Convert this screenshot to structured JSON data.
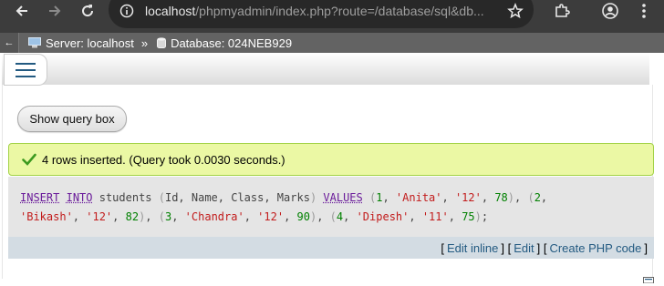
{
  "browser": {
    "url_host": "localhost",
    "url_path": "/phpmyadmin/index.php?route=/database/sql&db..."
  },
  "breadcrumb": {
    "collapse": "←",
    "server": "Server: localhost",
    "separator": "»",
    "database": "Database: 024NEB929"
  },
  "query_box_button": "Show query box",
  "success_message": "4 rows inserted. (Query took 0.0030 seconds.)",
  "sql": {
    "line1": [
      {
        "t": "INSERT",
        "c": "kw2"
      },
      {
        "t": " ",
        "c": ""
      },
      {
        "t": "INTO",
        "c": "kw2"
      },
      {
        "t": " students ",
        "c": "ident"
      },
      {
        "t": "(",
        "c": "pun"
      },
      {
        "t": "Id, Name, Class, Marks",
        "c": "ident"
      },
      {
        "t": ")",
        "c": "pun"
      },
      {
        "t": " ",
        "c": ""
      },
      {
        "t": "VALUES",
        "c": "kw2"
      },
      {
        "t": " ",
        "c": ""
      },
      {
        "t": "(",
        "c": "pun"
      },
      {
        "t": "1",
        "c": "num"
      },
      {
        "t": ", ",
        "c": "ident"
      },
      {
        "t": "'Anita'",
        "c": "str"
      },
      {
        "t": ", ",
        "c": "ident"
      },
      {
        "t": "'12'",
        "c": "str"
      },
      {
        "t": ", ",
        "c": "ident"
      },
      {
        "t": "78",
        "c": "num"
      },
      {
        "t": ")",
        "c": "pun"
      },
      {
        "t": ", ",
        "c": "ident"
      },
      {
        "t": "(",
        "c": "pun"
      },
      {
        "t": "2",
        "c": "num"
      },
      {
        "t": ",",
        "c": "ident"
      }
    ],
    "line2": [
      {
        "t": "'Bikash'",
        "c": "str"
      },
      {
        "t": ", ",
        "c": "ident"
      },
      {
        "t": "'12'",
        "c": "str"
      },
      {
        "t": ", ",
        "c": "ident"
      },
      {
        "t": "82",
        "c": "num"
      },
      {
        "t": ")",
        "c": "pun"
      },
      {
        "t": ", ",
        "c": "ident"
      },
      {
        "t": "(",
        "c": "pun"
      },
      {
        "t": "3",
        "c": "num"
      },
      {
        "t": ", ",
        "c": "ident"
      },
      {
        "t": "'Chandra'",
        "c": "str"
      },
      {
        "t": ", ",
        "c": "ident"
      },
      {
        "t": "'12'",
        "c": "str"
      },
      {
        "t": ", ",
        "c": "ident"
      },
      {
        "t": "90",
        "c": "num"
      },
      {
        "t": ")",
        "c": "pun"
      },
      {
        "t": ", ",
        "c": "ident"
      },
      {
        "t": "(",
        "c": "pun"
      },
      {
        "t": "4",
        "c": "num"
      },
      {
        "t": ", ",
        "c": "ident"
      },
      {
        "t": "'Dipesh'",
        "c": "str"
      },
      {
        "t": ", ",
        "c": "ident"
      },
      {
        "t": "'11'",
        "c": "str"
      },
      {
        "t": ", ",
        "c": "ident"
      },
      {
        "t": "75",
        "c": "num"
      },
      {
        "t": ")",
        "c": "pun"
      },
      {
        "t": ";",
        "c": "ident"
      }
    ]
  },
  "actions": {
    "open": "[",
    "edit_inline": "Edit inline",
    "mid1": "] [",
    "edit": "Edit",
    "mid2": "] [",
    "create_php": "Create PHP code",
    "close": "]"
  },
  "colors": {
    "success_bg": "#ebf8a4",
    "success_border": "#a2d246",
    "link": "#235a81"
  }
}
